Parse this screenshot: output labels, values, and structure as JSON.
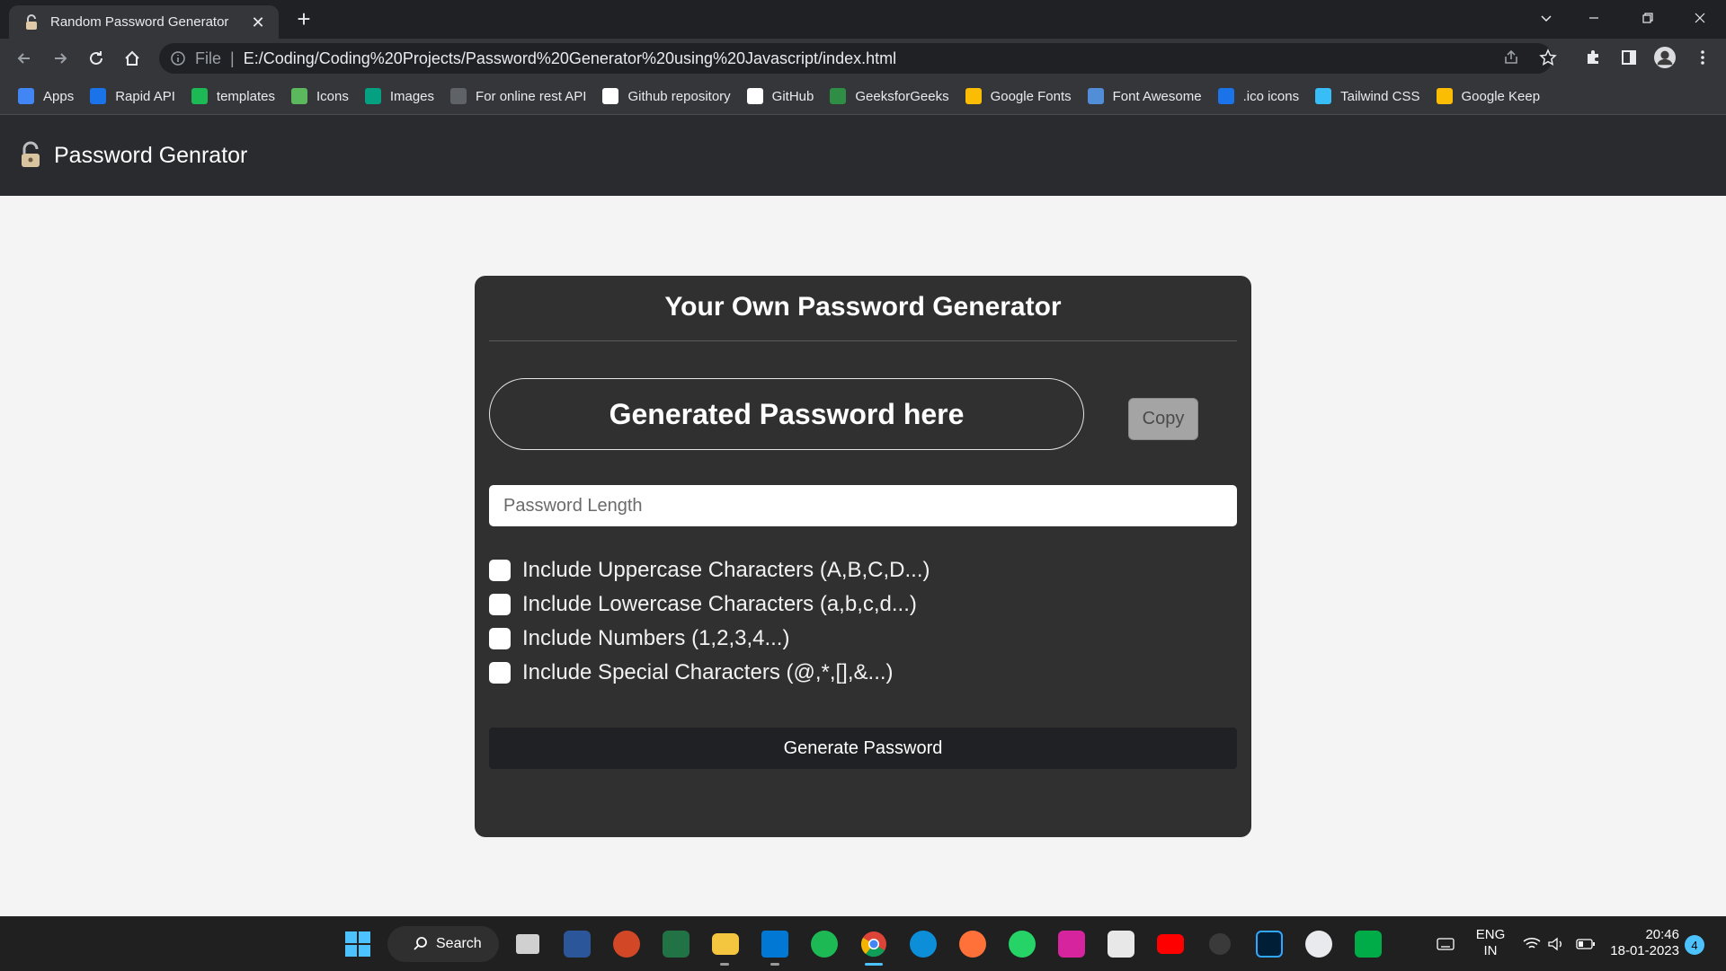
{
  "browser": {
    "tab_title": "Random Password Generator",
    "url_scheme": "File",
    "url": "E:/Coding/Coding%20Projects/Password%20Generator%20using%20Javascript/index.html",
    "bookmarks": [
      {
        "label": "Apps",
        "color": "#4285f4"
      },
      {
        "label": "Rapid API",
        "color": "#1a73e8"
      },
      {
        "label": "templates",
        "color": "#1db954"
      },
      {
        "label": "Icons",
        "color": "#5cb85c"
      },
      {
        "label": "Images",
        "color": "#05a081"
      },
      {
        "label": "For online rest API",
        "color": "#5f6368"
      },
      {
        "label": "Github repository",
        "color": "#ffffff"
      },
      {
        "label": "GitHub",
        "color": "#ffffff"
      },
      {
        "label": "GeeksforGeeks",
        "color": "#2f8d46"
      },
      {
        "label": "Google Fonts",
        "color": "#fbbc04"
      },
      {
        "label": "Font Awesome",
        "color": "#528dd7"
      },
      {
        "label": ".ico icons",
        "color": "#1a73e8"
      },
      {
        "label": "Tailwind CSS",
        "color": "#38bdf8"
      },
      {
        "label": "Google Keep",
        "color": "#fbbc04"
      }
    ]
  },
  "navbar": {
    "brand": "Password Genrator"
  },
  "card": {
    "title": "Your Own Password Generator",
    "password_display": "Generated Password here",
    "copy_label": "Copy",
    "length_placeholder": "Password Length",
    "options": [
      "Include Uppercase Characters (A,B,C,D...)",
      "Include Lowercase Characters (a,b,c,d...)",
      "Include Numbers (1,2,3,4...)",
      "Include Special Characters (@,*,[],&...)"
    ],
    "generate_label": "Generate Password"
  },
  "taskbar": {
    "search_label": "Search",
    "lang_line1": "ENG",
    "lang_line2": "IN",
    "time": "20:46",
    "date": "18-01-2023",
    "notification_count": "4"
  },
  "colors": {
    "card_bg": "#303030",
    "navbar_bg": "#292b2f",
    "page_bg": "#f4f4f4",
    "copy_button": "#a4a4a4",
    "generate_button": "#202124"
  }
}
